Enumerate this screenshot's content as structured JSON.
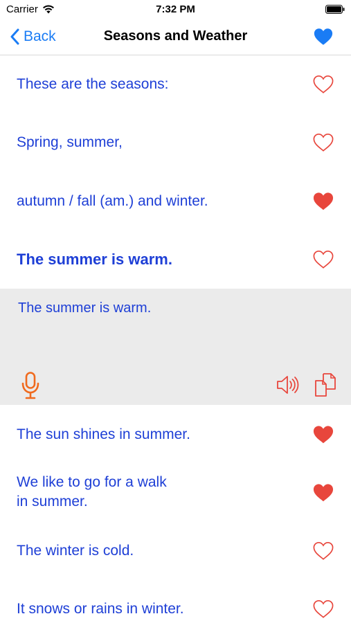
{
  "status": {
    "carrier": "Carrier",
    "time": "7:32 PM"
  },
  "nav": {
    "back_label": "Back",
    "title": "Seasons and Weather",
    "favorite_all": true
  },
  "colors": {
    "accent": "#1a7cf5",
    "text_blue": "#1e3fd6",
    "heart_red": "#e8463c",
    "icon_red": "#e8463c",
    "mic_orange": "#f06a1e",
    "panel_bg": "#ebebeb"
  },
  "icons": {
    "back": "chevron-left-icon",
    "favorite": "heart-icon",
    "mic": "microphone-icon",
    "speaker": "speaker-icon",
    "copy": "copy-icon"
  },
  "rows": [
    {
      "text": "These are the seasons:",
      "favorite": false
    },
    {
      "text": "Spring, summer,",
      "favorite": false
    },
    {
      "text": "autumn / fall (am.) and winter.",
      "favorite": true
    },
    {
      "text": "The summer is warm.",
      "favorite": false,
      "selected": true
    },
    {
      "text": "The sun shines in summer.",
      "favorite": true
    },
    {
      "line1": "We like to go for a walk",
      "line2": "in summer.",
      "favorite": true
    },
    {
      "text": "The winter is cold.",
      "favorite": false
    },
    {
      "text": "It snows or rains in winter.",
      "favorite": false
    }
  ],
  "detail_panel": {
    "text": "The summer is warm."
  }
}
